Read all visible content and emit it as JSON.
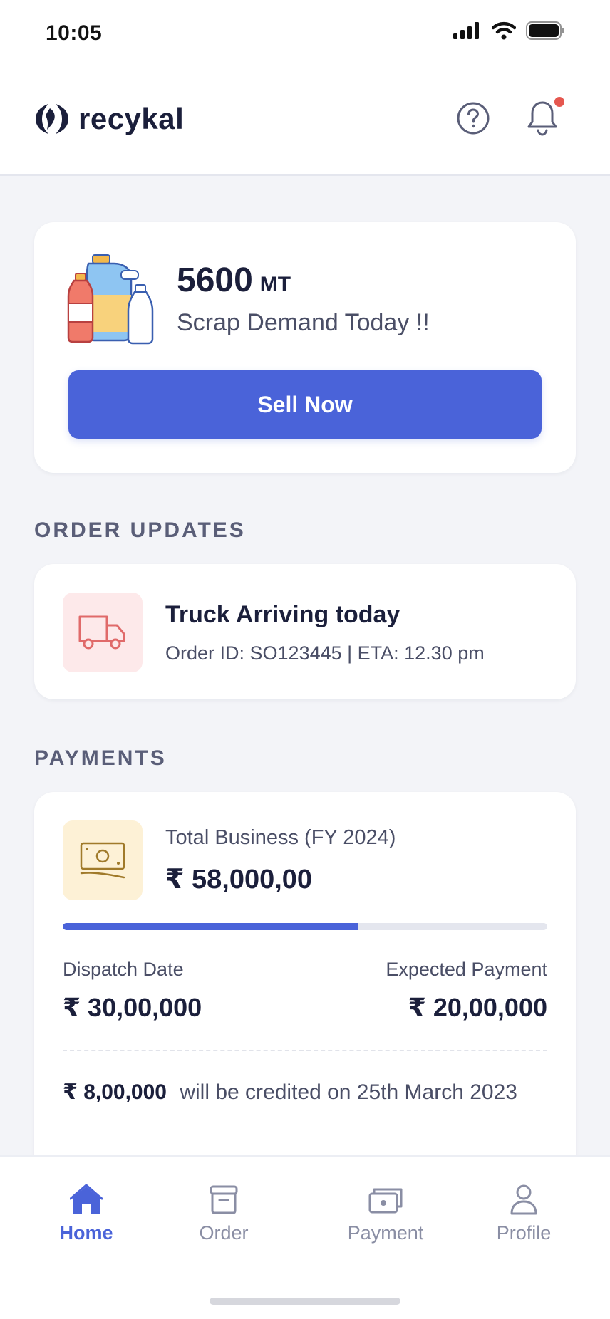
{
  "status_bar": {
    "time": "10:05"
  },
  "header": {
    "brand": "recykal",
    "help_icon": "help-circle-icon",
    "bell_icon": "bell-icon",
    "notification_dot_color": "#e5574f"
  },
  "demand_card": {
    "value": "5600",
    "unit": "MT",
    "label": "Scrap Demand Today !!",
    "button_label": "Sell Now"
  },
  "order_updates": {
    "section_title": "ORDER UPDATES",
    "item": {
      "title": "Truck Arriving today",
      "subtitle": "Order ID: SO123445 | ETA: 12.30 pm",
      "icon": "truck-icon"
    }
  },
  "payments": {
    "section_title": "PAYMENTS",
    "total_label": "Total Business (FY 2024)",
    "total_value": "₹ 58,000,00",
    "progress_fraction": 0.61,
    "dispatch_label": "Dispatch Date",
    "dispatch_value": "₹ 30,00,000",
    "expected_label": "Expected Payment",
    "expected_value": "₹ 20,00,000",
    "credit_amount": "₹ 8,00,000",
    "credit_text": "will be credited on 25th March 2023"
  },
  "bottom_nav": [
    {
      "label": "Home",
      "icon": "home-icon",
      "active": true
    },
    {
      "label": "Order",
      "icon": "box-icon",
      "active": false
    },
    {
      "label": "Payment",
      "icon": "wallet-icon",
      "active": false
    },
    {
      "label": "Profile",
      "icon": "user-icon",
      "active": false
    }
  ],
  "colors": {
    "accent": "#4a63d9",
    "text_dark": "#1b1f3b",
    "text_muted": "#4a4e66",
    "background": "#f3f4f8"
  }
}
